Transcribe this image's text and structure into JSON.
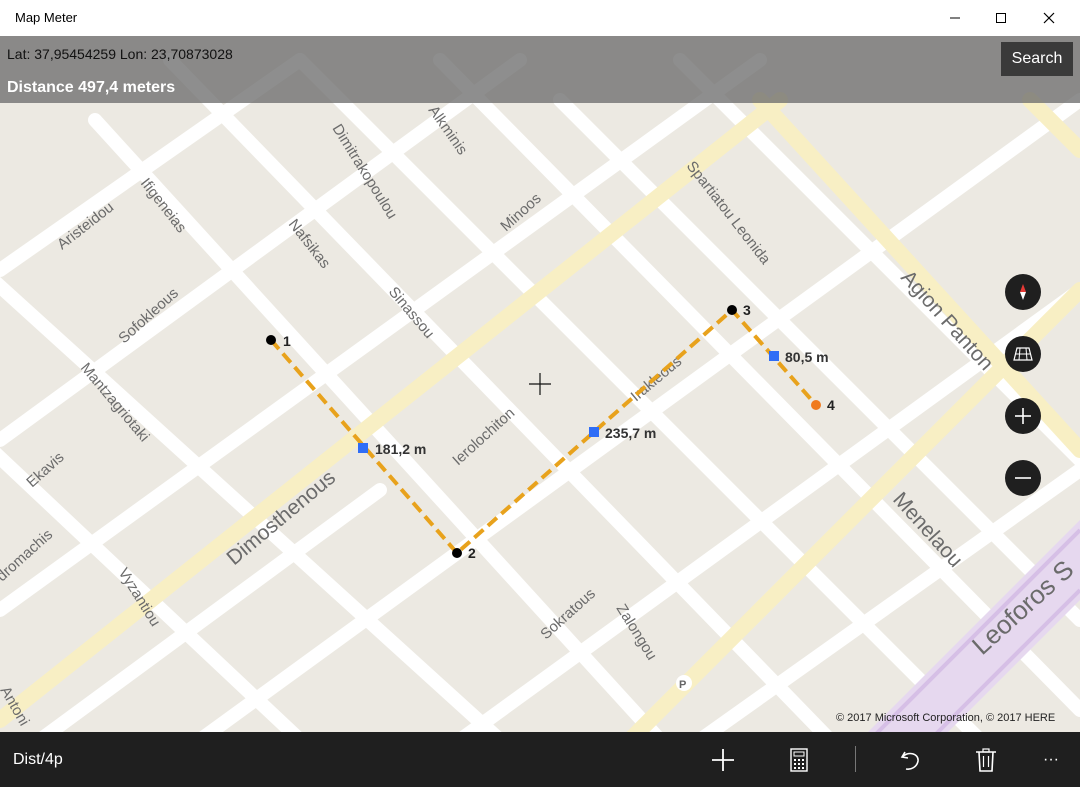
{
  "window": {
    "title": "Map Meter"
  },
  "info_bar": {
    "coordinates": "Lat: 37,95454259 Lon: 23,70873028",
    "distance": "Distance 497,4 meters",
    "search_label": "Search"
  },
  "map": {
    "streets": [
      "Aristeidou",
      "Ifigeneias",
      "Dimitrakopoulou",
      "Alkminis",
      "Nafsikas",
      "Minoos",
      "Spartiatou Leonida",
      "Agion Panton",
      "Sofokleous",
      "Sinassou",
      "Mantzagriotaki",
      "Ekavis",
      "Dimosthenous",
      "Ierolochiton",
      "Irakleous",
      "Menelaou",
      "dromachis",
      "Vyzantiou",
      "Sokratous",
      "Zalongou",
      "Leoforos S",
      "Antoni"
    ],
    "points": [
      {
        "label": "1"
      },
      {
        "label": "2"
      },
      {
        "label": "3"
      },
      {
        "label": "4"
      }
    ],
    "segments": [
      {
        "label": "181,2 m"
      },
      {
        "label": "235,7 m"
      },
      {
        "label": "80,5 m"
      }
    ],
    "parking_symbol": "P",
    "copyright": "© 2017 Microsoft Corporation, © 2017 HERE",
    "route_color": "#e8a21c",
    "marker_color": "#2f6df6",
    "end_color": "#f07a1e"
  },
  "command_bar": {
    "label": "Dist/4p",
    "more": "···"
  }
}
